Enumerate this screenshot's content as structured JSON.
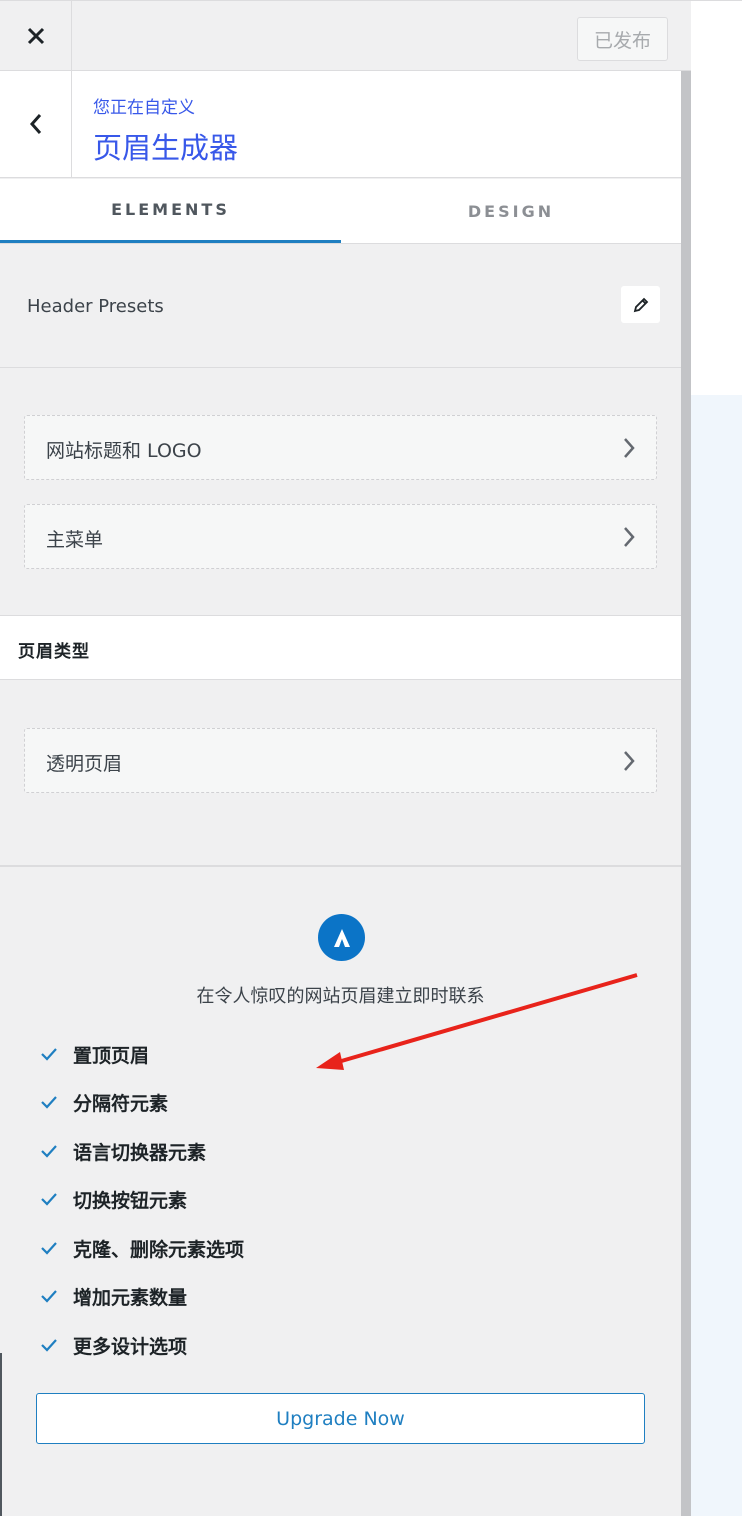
{
  "topbar": {
    "close_icon": "close-icon",
    "published_label": "已发布"
  },
  "header": {
    "crumb": "您正在自定义",
    "title": "页眉生成器",
    "back_icon": "chevron-left-icon"
  },
  "tabs": [
    {
      "label": "ELEMENTS",
      "active": true
    },
    {
      "label": "DESIGN",
      "active": false
    }
  ],
  "presets": {
    "label": "Header Presets",
    "edit_icon": "pencil-icon"
  },
  "nav_items": [
    {
      "label": "网站标题和 LOGO"
    },
    {
      "label": "主菜单"
    }
  ],
  "header_type": {
    "title": "页眉类型",
    "items": [
      {
        "label": "透明页眉"
      }
    ]
  },
  "upsell": {
    "logo_icon": "astra-logo-icon",
    "title": "在令人惊叹的网站页眉建立即时联系",
    "features": [
      "置顶页眉",
      "分隔符元素",
      "语言切换器元素",
      "切换按钮元素",
      "克隆、删除元素选项",
      "增加元素数量",
      "更多设计选项"
    ],
    "upgrade_label": "Upgrade Now"
  },
  "colors": {
    "accent": "#1f7fc1",
    "title_blue": "#3858e9",
    "annotation_red": "#e8231b"
  }
}
